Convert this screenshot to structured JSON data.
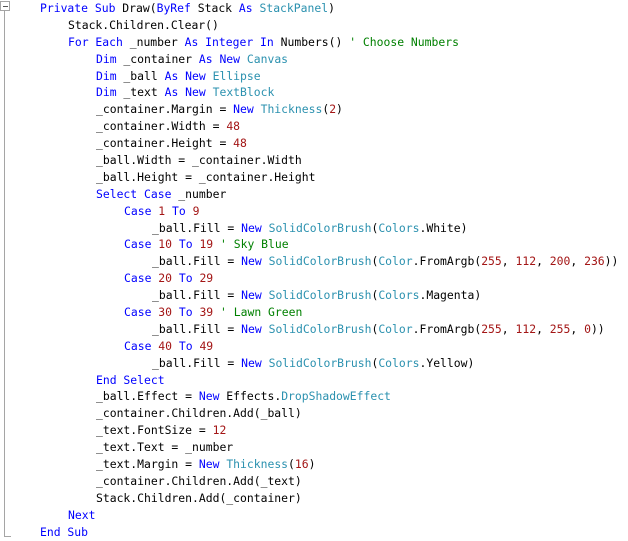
{
  "editor": {
    "language": "Visual Basic",
    "colors": {
      "keyword": "#0000ff",
      "type": "#2b91af",
      "number": "#a31515",
      "comment": "#008000"
    },
    "lines": [
      {
        "i": 0,
        "tk": [
          [
            "k",
            "Private Sub"
          ],
          [
            "p",
            " Draw("
          ],
          [
            "k",
            "ByRef"
          ],
          [
            "p",
            " Stack "
          ],
          [
            "k",
            "As"
          ],
          [
            "p",
            " "
          ],
          [
            "t",
            "StackPanel"
          ],
          [
            "p",
            ")"
          ]
        ]
      },
      {
        "i": 1,
        "tk": [
          [
            "p",
            "Stack.Children.Clear()"
          ]
        ]
      },
      {
        "i": 1,
        "tk": [
          [
            "k",
            "For Each"
          ],
          [
            "p",
            " _number "
          ],
          [
            "k",
            "As Integer In"
          ],
          [
            "p",
            " Numbers() "
          ],
          [
            "c",
            "' Choose Numbers"
          ]
        ]
      },
      {
        "i": 2,
        "tk": [
          [
            "k",
            "Dim"
          ],
          [
            "p",
            " _container "
          ],
          [
            "k",
            "As New"
          ],
          [
            "p",
            " "
          ],
          [
            "t",
            "Canvas"
          ]
        ]
      },
      {
        "i": 2,
        "tk": [
          [
            "k",
            "Dim"
          ],
          [
            "p",
            " _ball "
          ],
          [
            "k",
            "As New"
          ],
          [
            "p",
            " "
          ],
          [
            "t",
            "Ellipse"
          ]
        ]
      },
      {
        "i": 2,
        "tk": [
          [
            "k",
            "Dim"
          ],
          [
            "p",
            " _text "
          ],
          [
            "k",
            "As New"
          ],
          [
            "p",
            " "
          ],
          [
            "t",
            "TextBlock"
          ]
        ]
      },
      {
        "i": 2,
        "tk": [
          [
            "p",
            "_container.Margin = "
          ],
          [
            "k",
            "New"
          ],
          [
            "p",
            " "
          ],
          [
            "t",
            "Thickness"
          ],
          [
            "p",
            "("
          ],
          [
            "n",
            "2"
          ],
          [
            "p",
            ")"
          ]
        ]
      },
      {
        "i": 2,
        "tk": [
          [
            "p",
            "_container.Width = "
          ],
          [
            "n",
            "48"
          ]
        ]
      },
      {
        "i": 2,
        "tk": [
          [
            "p",
            "_container.Height = "
          ],
          [
            "n",
            "48"
          ]
        ]
      },
      {
        "i": 2,
        "tk": [
          [
            "p",
            "_ball.Width = _container.Width"
          ]
        ]
      },
      {
        "i": 2,
        "tk": [
          [
            "p",
            "_ball.Height = _container.Height"
          ]
        ]
      },
      {
        "i": 2,
        "tk": [
          [
            "k",
            "Select Case"
          ],
          [
            "p",
            " _number"
          ]
        ]
      },
      {
        "i": 3,
        "tk": [
          [
            "k",
            "Case"
          ],
          [
            "p",
            " "
          ],
          [
            "n",
            "1"
          ],
          [
            "p",
            " "
          ],
          [
            "k",
            "To"
          ],
          [
            "p",
            " "
          ],
          [
            "n",
            "9"
          ]
        ]
      },
      {
        "i": 4,
        "tk": [
          [
            "p",
            "_ball.Fill = "
          ],
          [
            "k",
            "New"
          ],
          [
            "p",
            " "
          ],
          [
            "t",
            "SolidColorBrush"
          ],
          [
            "p",
            "("
          ],
          [
            "t",
            "Colors"
          ],
          [
            "p",
            ".White)"
          ]
        ]
      },
      {
        "i": 3,
        "tk": [
          [
            "k",
            "Case"
          ],
          [
            "p",
            " "
          ],
          [
            "n",
            "10"
          ],
          [
            "p",
            " "
          ],
          [
            "k",
            "To"
          ],
          [
            "p",
            " "
          ],
          [
            "n",
            "19"
          ],
          [
            "p",
            " "
          ],
          [
            "c",
            "' Sky Blue"
          ]
        ]
      },
      {
        "i": 4,
        "tk": [
          [
            "p",
            "_ball.Fill = "
          ],
          [
            "k",
            "New"
          ],
          [
            "p",
            " "
          ],
          [
            "t",
            "SolidColorBrush"
          ],
          [
            "p",
            "("
          ],
          [
            "t",
            "Color"
          ],
          [
            "p",
            ".FromArgb("
          ],
          [
            "n",
            "255"
          ],
          [
            "p",
            ", "
          ],
          [
            "n",
            "112"
          ],
          [
            "p",
            ", "
          ],
          [
            "n",
            "200"
          ],
          [
            "p",
            ", "
          ],
          [
            "n",
            "236"
          ],
          [
            "p",
            "))"
          ]
        ]
      },
      {
        "i": 3,
        "tk": [
          [
            "k",
            "Case"
          ],
          [
            "p",
            " "
          ],
          [
            "n",
            "20"
          ],
          [
            "p",
            " "
          ],
          [
            "k",
            "To"
          ],
          [
            "p",
            " "
          ],
          [
            "n",
            "29"
          ]
        ]
      },
      {
        "i": 4,
        "tk": [
          [
            "p",
            "_ball.Fill = "
          ],
          [
            "k",
            "New"
          ],
          [
            "p",
            " "
          ],
          [
            "t",
            "SolidColorBrush"
          ],
          [
            "p",
            "("
          ],
          [
            "t",
            "Colors"
          ],
          [
            "p",
            ".Magenta)"
          ]
        ]
      },
      {
        "i": 3,
        "tk": [
          [
            "k",
            "Case"
          ],
          [
            "p",
            " "
          ],
          [
            "n",
            "30"
          ],
          [
            "p",
            " "
          ],
          [
            "k",
            "To"
          ],
          [
            "p",
            " "
          ],
          [
            "n",
            "39"
          ],
          [
            "p",
            " "
          ],
          [
            "c",
            "' Lawn Green"
          ]
        ]
      },
      {
        "i": 4,
        "tk": [
          [
            "p",
            "_ball.Fill = "
          ],
          [
            "k",
            "New"
          ],
          [
            "p",
            " "
          ],
          [
            "t",
            "SolidColorBrush"
          ],
          [
            "p",
            "("
          ],
          [
            "t",
            "Color"
          ],
          [
            "p",
            ".FromArgb("
          ],
          [
            "n",
            "255"
          ],
          [
            "p",
            ", "
          ],
          [
            "n",
            "112"
          ],
          [
            "p",
            ", "
          ],
          [
            "n",
            "255"
          ],
          [
            "p",
            ", "
          ],
          [
            "n",
            "0"
          ],
          [
            "p",
            "))"
          ]
        ]
      },
      {
        "i": 3,
        "tk": [
          [
            "k",
            "Case"
          ],
          [
            "p",
            " "
          ],
          [
            "n",
            "40"
          ],
          [
            "p",
            " "
          ],
          [
            "k",
            "To"
          ],
          [
            "p",
            " "
          ],
          [
            "n",
            "49"
          ]
        ]
      },
      {
        "i": 4,
        "tk": [
          [
            "p",
            "_ball.Fill = "
          ],
          [
            "k",
            "New"
          ],
          [
            "p",
            " "
          ],
          [
            "t",
            "SolidColorBrush"
          ],
          [
            "p",
            "("
          ],
          [
            "t",
            "Colors"
          ],
          [
            "p",
            ".Yellow)"
          ]
        ]
      },
      {
        "i": 2,
        "tk": [
          [
            "k",
            "End Select"
          ]
        ]
      },
      {
        "i": 2,
        "tk": [
          [
            "p",
            "_ball.Effect = "
          ],
          [
            "k",
            "New"
          ],
          [
            "p",
            " Effects."
          ],
          [
            "t",
            "DropShadowEffect"
          ]
        ]
      },
      {
        "i": 2,
        "tk": [
          [
            "p",
            "_container.Children.Add(_ball)"
          ]
        ]
      },
      {
        "i": 2,
        "tk": [
          [
            "p",
            "_text.FontSize = "
          ],
          [
            "n",
            "12"
          ]
        ]
      },
      {
        "i": 2,
        "tk": [
          [
            "p",
            "_text.Text = _number"
          ]
        ]
      },
      {
        "i": 2,
        "tk": [
          [
            "p",
            "_text.Margin = "
          ],
          [
            "k",
            "New"
          ],
          [
            "p",
            " "
          ],
          [
            "t",
            "Thickness"
          ],
          [
            "p",
            "("
          ],
          [
            "n",
            "16"
          ],
          [
            "p",
            ")"
          ]
        ]
      },
      {
        "i": 2,
        "tk": [
          [
            "p",
            "_container.Children.Add(_text)"
          ]
        ]
      },
      {
        "i": 2,
        "tk": [
          [
            "p",
            "Stack.Children.Add(_container)"
          ]
        ]
      },
      {
        "i": 1,
        "tk": [
          [
            "k",
            "Next"
          ]
        ]
      },
      {
        "i": 0,
        "tk": [
          [
            "k",
            "End Sub"
          ]
        ]
      }
    ]
  }
}
